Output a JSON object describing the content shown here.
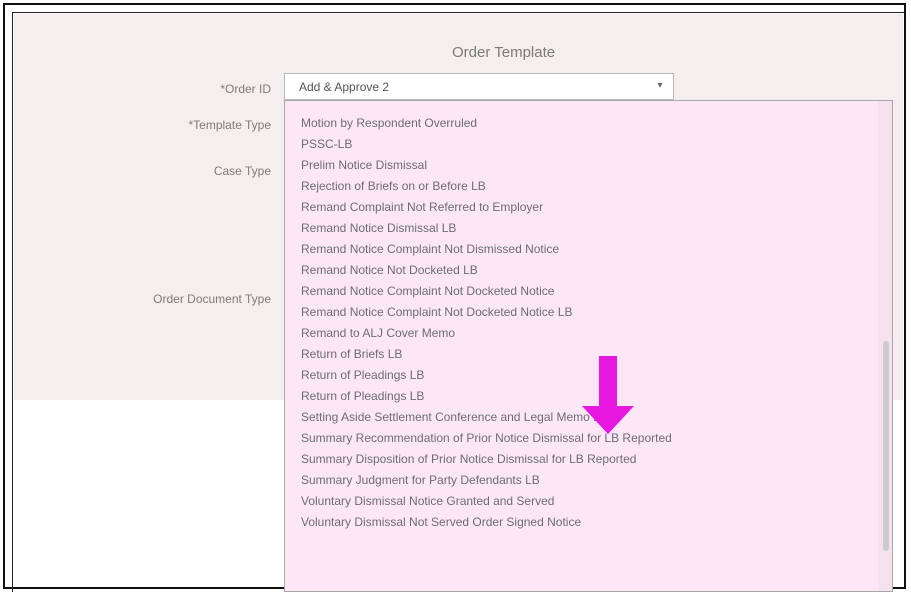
{
  "form": {
    "title": "Order Template",
    "labels": {
      "order_id": "*Order ID",
      "template_type": "*Template Type",
      "case_type": "Case Type",
      "order_document_type": "Order Document Type"
    },
    "selected_value": "Add & Approve 2",
    "options": [
      "Motion by Respondent Overruled",
      "PSSC-LB",
      "Prelim Notice Dismissal",
      "Rejection of Briefs on or Before LB",
      "Remand Complaint Not Referred to Employer",
      "Remand Notice Dismissal LB",
      "Remand Notice Complaint Not Dismissed Notice",
      "Remand Notice Not Docketed LB",
      "Remand Notice Complaint Not Docketed Notice",
      "Remand Notice Complaint Not Docketed Notice LB",
      "Remand to ALJ Cover Memo",
      "Return of Briefs LB",
      "Return of Pleadings LB",
      "Return of Pleadings LB",
      "Setting Aside Settlement Conference and Legal Memo LB",
      "Summary Recommendation of Prior Notice Dismissal for LB Reported",
      "Summary Disposition of Prior Notice Dismissal for LB Reported",
      "Summary Judgment for Party Defendants LB",
      "Voluntary Dismissal Notice Granted and Served",
      "Voluntary Dismissal Not Served Order Signed Notice"
    ]
  },
  "annotation": {
    "arrow_color": "#e817e0"
  }
}
